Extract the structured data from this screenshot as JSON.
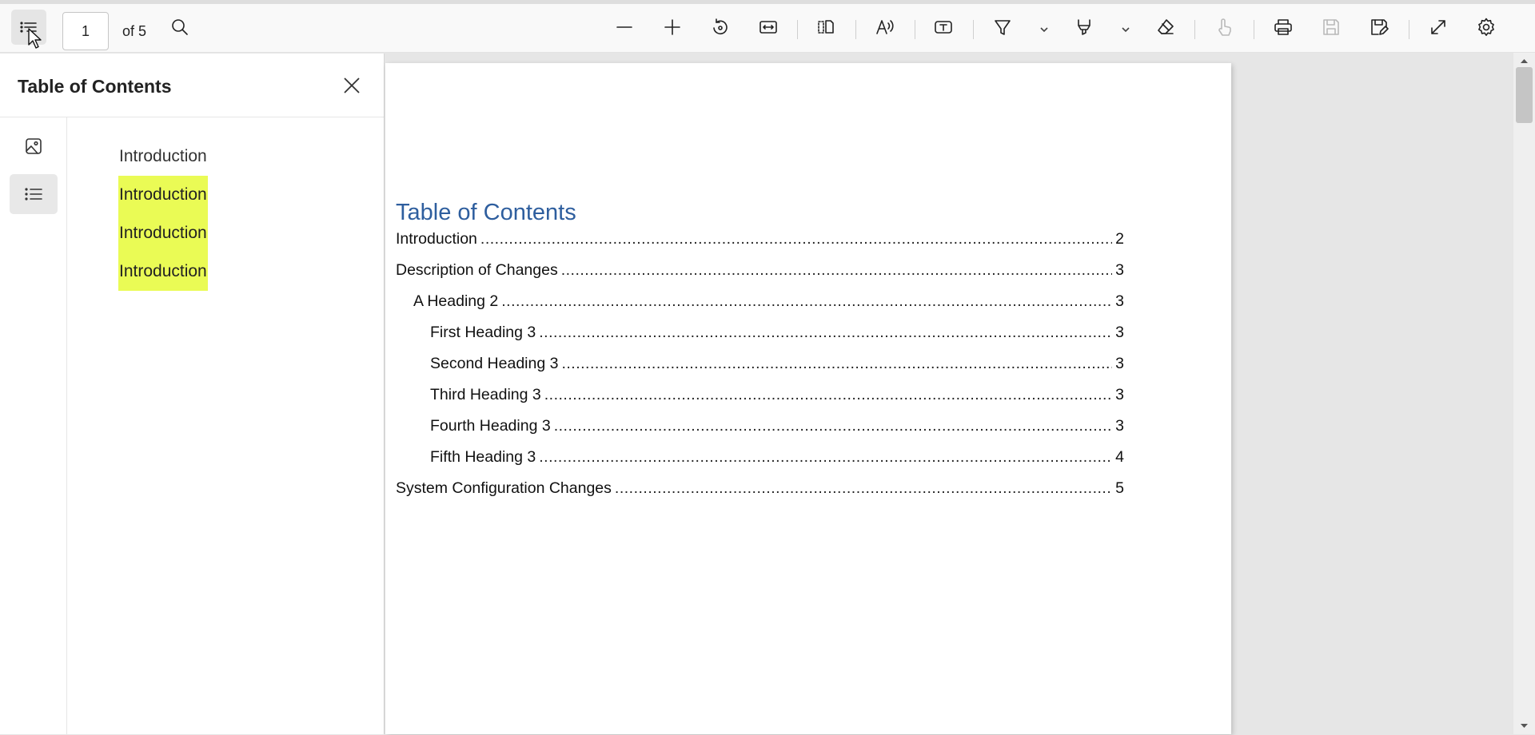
{
  "toolbar": {
    "page_current": "1",
    "page_total": "of 5",
    "buttons": [
      {
        "name": "contents-icon"
      },
      {
        "name": "search-icon"
      },
      {
        "name": "zoom-out-icon"
      },
      {
        "name": "zoom-in-icon"
      },
      {
        "name": "rotate-icon"
      },
      {
        "name": "fit-width-icon"
      },
      {
        "name": "page-view-icon"
      },
      {
        "name": "read-aloud-icon"
      },
      {
        "name": "text-box-icon"
      },
      {
        "name": "draw-icon"
      },
      {
        "name": "highlight-icon"
      },
      {
        "name": "eraser-icon"
      },
      {
        "name": "touch-write-icon"
      },
      {
        "name": "print-icon"
      },
      {
        "name": "save-icon"
      },
      {
        "name": "save-as-icon"
      },
      {
        "name": "fullscreen-icon"
      },
      {
        "name": "settings-icon"
      }
    ]
  },
  "sidebar": {
    "title": "Table of Contents",
    "outline": [
      {
        "label": "Introduction",
        "highlighted": false
      },
      {
        "label": "Introduction",
        "highlighted": true
      },
      {
        "label": "Introduction",
        "highlighted": true
      },
      {
        "label": "Introduction",
        "highlighted": true
      }
    ]
  },
  "document": {
    "toc_heading": "Table of Contents",
    "toc_entries": [
      {
        "title": "Introduction",
        "page": "2",
        "level": 1
      },
      {
        "title": "Description of Changes",
        "page": "3",
        "level": 1
      },
      {
        "title": "A Heading 2",
        "page": "3",
        "level": 2
      },
      {
        "title": "First Heading 3",
        "page": "3",
        "level": 3
      },
      {
        "title": "Second Heading 3",
        "page": "3",
        "level": 3
      },
      {
        "title": "Third Heading 3",
        "page": "3",
        "level": 3
      },
      {
        "title": "Fourth Heading 3",
        "page": "3",
        "level": 3
      },
      {
        "title": "Fifth Heading 3",
        "page": "4",
        "level": 3
      },
      {
        "title": "System Configuration Changes",
        "page": "5",
        "level": 1
      }
    ]
  },
  "colors": {
    "highlight": "#eafb55",
    "toc_heading": "#2e5e9e"
  }
}
